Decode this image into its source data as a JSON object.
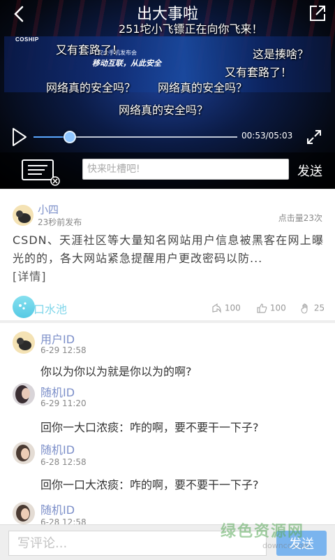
{
  "video": {
    "title": "出大事啦",
    "stage": {
      "brand": "COSHIP",
      "event_text": "安全手机发布会",
      "slogan": "移动互联，从此安全"
    },
    "danmu": [
      "251坨小飞镖正在向你飞来！",
      "又有套路了！",
      "这是揍啥？",
      "又有套路了！",
      "网络真的安全吗？",
      "网络真的安全吗？",
      "网络真的安全吗？"
    ],
    "controls": {
      "time": "00:53/05:03",
      "progress": 0.175
    },
    "danmu_input_placeholder": "快来吐槽吧!",
    "danmu_send": "发送"
  },
  "post": {
    "author": "小四",
    "time": "23秒前发布",
    "clicks": "点击量23次",
    "body": "CSDN、天涯社区等大量知名网站用户信息被黑客在网上曝光的的，各大网站紧急提醒用户更改密码以防...",
    "more": "[详情]",
    "site_name": "口水池",
    "stats": {
      "shares": "100",
      "likes": "100",
      "claps": "25"
    }
  },
  "comments": [
    {
      "user": "用户ID",
      "time": "6-29   12:58",
      "text": "你以为你以为就是你以为的啊?"
    },
    {
      "user": "随机ID",
      "time": "6-29   11:20",
      "text": "回你一大口浓痰：咋的啊，要不要干一下子?"
    },
    {
      "user": "随机ID",
      "time": "6-28   12:58",
      "text": "回你一口大浓痰：咋的啊，要不要干一下子?"
    },
    {
      "user": "随机ID",
      "time": "6-28   12:58",
      "text": ""
    }
  ],
  "bottom": {
    "placeholder": "写评论...",
    "send": "发送"
  },
  "watermark": {
    "cn": "绿色资源网",
    "en": "downcc.com"
  },
  "colors": {
    "accent": "#7ab4ee",
    "username": "#7c8fc9",
    "progress": "#5aa7ff"
  }
}
